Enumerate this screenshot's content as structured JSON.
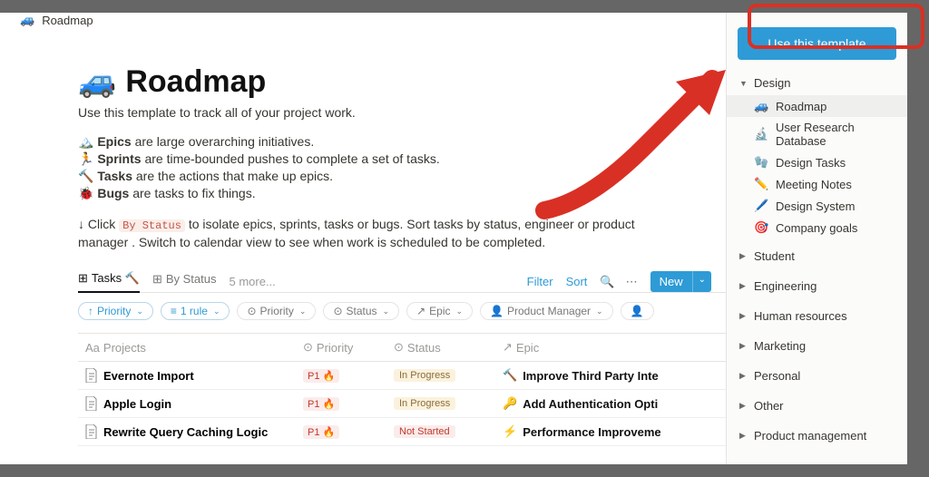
{
  "crumb": {
    "icon": "🚙",
    "title": "Roadmap"
  },
  "page": {
    "emoji": "🚙",
    "title": "Roadmap",
    "subtitle": "Use this template to track all of your project work.",
    "bullets": {
      "epics_icon": "🏔️",
      "epics_label": "Epics",
      "epics_desc": " are large overarching initiatives.",
      "sprints_icon": "🏃",
      "sprints_label": "Sprints",
      "sprints_desc": " are time-bounded pushes to complete a set of tasks.",
      "tasks_icon": "🔨",
      "tasks_label": "Tasks",
      "tasks_desc": " are the actions that make up epics.",
      "bugs_icon": "🐞",
      "bugs_label": "Bugs",
      "bugs_desc": " are tasks to fix things."
    },
    "tip_prefix": "↓ Click ",
    "tip_tag": "By Status",
    "tip_suffix": " to isolate epics, sprints, tasks or bugs. Sort tasks by status, engineer or product manager . Switch to calendar view to see when work is scheduled to be completed."
  },
  "tabs": {
    "tasks": "Tasks 🔨",
    "by_status": "By Status",
    "more": "5 more...",
    "filter": "Filter",
    "sort": "Sort",
    "new": "New"
  },
  "filters": {
    "priority_sort": "Priority",
    "rule": "1 rule",
    "priority": "Priority",
    "status": "Status",
    "epic": "Epic",
    "pm": "Product Manager"
  },
  "columns": {
    "projects": "Projects",
    "priority": "Priority",
    "status": "Status",
    "epic": "Epic"
  },
  "rows": [
    {
      "name": "Evernote Import",
      "priority": "P1 🔥",
      "status_label": "In Progress",
      "status_class": "progress",
      "epic_icon": "🔨",
      "epic": "Improve Third Party Inte"
    },
    {
      "name": "Apple Login",
      "priority": "P1 🔥",
      "status_label": "In Progress",
      "status_class": "progress",
      "epic_icon": "🔑",
      "epic": "Add Authentication Opti"
    },
    {
      "name": "Rewrite Query Caching Logic",
      "priority": "P1 🔥",
      "status_label": "Not Started",
      "status_class": "notstarted",
      "epic_icon": "⚡",
      "epic": "Performance Improveme"
    }
  ],
  "sidebar": {
    "cta": "Use this template",
    "design": {
      "label": "Design",
      "items": [
        {
          "icon": "🚙",
          "label": "Roadmap",
          "active": true
        },
        {
          "icon": "🔬",
          "label": "User Research Database"
        },
        {
          "icon": "🧤",
          "label": "Design Tasks"
        },
        {
          "icon": "✏️",
          "label": "Meeting Notes"
        },
        {
          "icon": "🖊️",
          "label": "Design System"
        },
        {
          "icon": "🎯",
          "label": "Company goals"
        }
      ]
    },
    "sections": [
      "Student",
      "Engineering",
      "Human resources",
      "Marketing",
      "Personal",
      "Other",
      "Product management"
    ]
  }
}
